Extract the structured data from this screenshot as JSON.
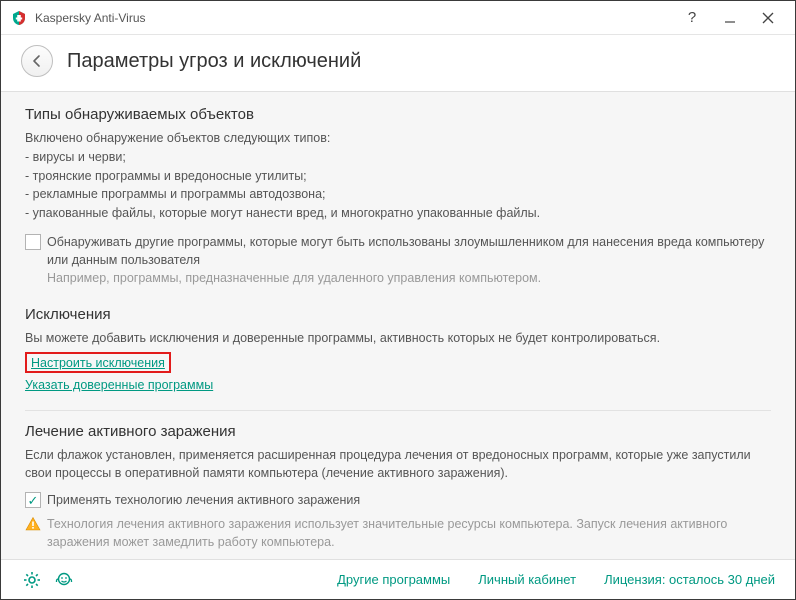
{
  "app_title": "Kaspersky Anti-Virus",
  "page_title": "Параметры угроз и исключений",
  "sections": {
    "detected_types": {
      "heading": "Типы обнаруживаемых объектов",
      "intro": "Включено обнаружение объектов следующих типов:",
      "items": [
        "- вирусы и черви;",
        "- троянские программы и вредоносные утилиты;",
        "- рекламные программы и программы автодозвона;",
        "- упакованные файлы, которые могут нанести вред, и многократно упакованные файлы."
      ],
      "other_checkbox": {
        "checked": false,
        "label": "Обнаруживать другие программы, которые могут быть использованы злоумышленником для нанесения вреда компьютеру или данным пользователя",
        "hint": "Например, программы, предназначенные для удаленного управления компьютером."
      }
    },
    "exclusions": {
      "heading": "Исключения",
      "intro": "Вы можете добавить исключения и доверенные программы, активность которых не будет контролироваться.",
      "link_configure": "Настроить исключения",
      "link_trusted": "Указать доверенные программы"
    },
    "cure": {
      "heading": "Лечение активного заражения",
      "intro": "Если флажок установлен, применяется расширенная процедура лечения от вредоносных программ, которые уже запустили свои процессы в оперативной памяти компьютера (лечение активного заражения).",
      "checkbox": {
        "checked": true,
        "label": "Применять технологию лечения активного заражения"
      },
      "warning": "Технология лечения активного заражения использует значительные ресурсы компьютера. Запуск лечения активного заражения может замедлить работу компьютера."
    }
  },
  "footer": {
    "other_programs": "Другие программы",
    "account": "Личный кабинет",
    "license": "Лицензия: осталось 30 дней"
  }
}
